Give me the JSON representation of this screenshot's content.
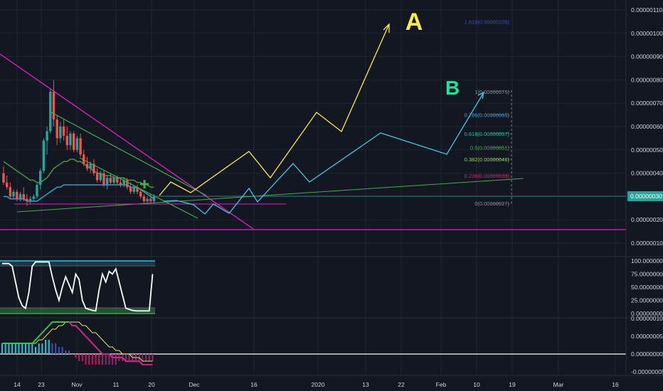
{
  "theme": {
    "background": "#131722",
    "grid": "#1f2433",
    "axis_text": "#d1d4dc",
    "bull": "#26a69a",
    "bear": "#ef5350",
    "magenta": "#e91ec8",
    "green_line": "#3fae48",
    "yellow": "#ffeb3b",
    "cyan": "#40c8e0",
    "current_price_bg": "#26a69a"
  },
  "price_axis": {
    "labels": [
      "0.00000110",
      "0.00000100",
      "0.00000090",
      "0.00000080",
      "0.00000070",
      "0.00000060",
      "0.00000050",
      "0.00000040",
      "0.00000020",
      "0.00000010"
    ],
    "current_price": "0.00000030"
  },
  "stoch_axis": {
    "labels": [
      "100.00000000",
      "75.00000000",
      "50.00000000",
      "25.00000000",
      "0.00000000"
    ]
  },
  "macd_axis": {
    "labels": [
      "0.00000010",
      "0.00000005",
      "0.00000000",
      "-0.00000005"
    ]
  },
  "time_axis": {
    "labels": [
      "14",
      "23",
      "Nov",
      "11",
      "20",
      "Dec",
      "16",
      "2020",
      "13",
      "22",
      "Feb",
      "10",
      "19",
      "Mar",
      "16"
    ]
  },
  "annotations": {
    "target_a": "A",
    "target_b": "B"
  },
  "fib_levels": [
    {
      "label": "1.618(0.00000105)",
      "value": 1.05e-06,
      "color": "#3f51b5"
    },
    {
      "label": "1(0.00000075)",
      "value": 7.5e-07,
      "color": "#8a8f9c"
    },
    {
      "label": "0.786(0.00000065)",
      "value": 6.5e-07,
      "color": "#40a8e0"
    },
    {
      "label": "0.618(0.00000057)",
      "value": 5.7e-07,
      "color": "#26c6a0"
    },
    {
      "label": "0.5(0.00000051)",
      "value": 5.1e-07,
      "color": "#4caf50"
    },
    {
      "label": "0.382(0.00000046)",
      "value": 4.6e-07,
      "color": "#9ccc65"
    },
    {
      "label": "0.236(0.00000039)",
      "value": 3.9e-07,
      "color": "#e91e63"
    },
    {
      "label": "0(0.00000027)",
      "value": 2.7e-07,
      "color": "#8a8f9c"
    }
  ],
  "chart_data": {
    "type": "candlestick",
    "y_range": [
      5e-09,
      1.15e-07
    ],
    "candles": [
      [
        4e-07,
        4.3e-07,
        3.5e-07,
        3.6e-07
      ],
      [
        3.6e-07,
        3.9e-07,
        3.3e-07,
        3.4e-07
      ],
      [
        3.4e-07,
        3.6e-07,
        2.9e-07,
        3e-07
      ],
      [
        3e-07,
        3.3e-07,
        2.9e-07,
        3.2e-07
      ],
      [
        3.2e-07,
        3.3e-07,
        2.8e-07,
        2.9e-07
      ],
      [
        2.9e-07,
        3.2e-07,
        2.8e-07,
        3.1e-07
      ],
      [
        3.1e-07,
        3.4e-07,
        2.8e-07,
        2.9e-07
      ],
      [
        2.9e-07,
        3.1e-07,
        2.6e-07,
        2.8e-07
      ],
      [
        2.8e-07,
        3e-07,
        2.7e-07,
        2.9e-07
      ],
      [
        2.9e-07,
        3.1e-07,
        2.8e-07,
        3e-07
      ],
      [
        3e-07,
        3.6e-07,
        2.9e-07,
        3.5e-07
      ],
      [
        3.5e-07,
        4.2e-07,
        3.3e-07,
        4.1e-07
      ],
      [
        4.1e-07,
        5.5e-07,
        4e-07,
        5.4e-07
      ],
      [
        5.4e-07,
        6e-07,
        4.8e-07,
        5.8e-07
      ],
      [
        5.8e-07,
        7.6e-07,
        5.7e-07,
        7.5e-07
      ],
      [
        7.5e-07,
        8e-07,
        6e-07,
        6.3e-07
      ],
      [
        6.3e-07,
        6.5e-07,
        5.2e-07,
        5.5e-07
      ],
      [
        5.5e-07,
        6.2e-07,
        5.3e-07,
        6e-07
      ],
      [
        6e-07,
        6.3e-07,
        5.4e-07,
        5.6e-07
      ],
      [
        5.6e-07,
        6e-07,
        5e-07,
        5.2e-07
      ],
      [
        5.2e-07,
        5.8e-07,
        5e-07,
        5.7e-07
      ],
      [
        5.7e-07,
        5.8e-07,
        4.9e-07,
        5e-07
      ],
      [
        5e-07,
        5.6e-07,
        4.9e-07,
        5.5e-07
      ],
      [
        5.5e-07,
        5.7e-07,
        4.7e-07,
        4.8e-07
      ],
      [
        4.8e-07,
        5e-07,
        4.3e-07,
        4.4e-07
      ],
      [
        4.4e-07,
        4.7e-07,
        4.1e-07,
        4.2e-07
      ],
      [
        4.2e-07,
        4.5e-07,
        4e-07,
        4.4e-07
      ],
      [
        4.4e-07,
        4.6e-07,
        3.9e-07,
        4e-07
      ],
      [
        4e-07,
        4.2e-07,
        3.6e-07,
        3.7e-07
      ],
      [
        3.7e-07,
        4.1e-07,
        3.6e-07,
        4e-07
      ],
      [
        4e-07,
        4.1e-07,
        3.4e-07,
        3.5e-07
      ],
      [
        3.5e-07,
        3.9e-07,
        3.3e-07,
        3.8e-07
      ],
      [
        3.8e-07,
        4e-07,
        3.5e-07,
        3.6e-07
      ],
      [
        3.6e-07,
        3.9e-07,
        3.5e-07,
        3.8e-07
      ],
      [
        3.8e-07,
        3.9e-07,
        3.5e-07,
        3.6e-07
      ],
      [
        3.6e-07,
        3.8e-07,
        3.4e-07,
        3.5e-07
      ],
      [
        3.5e-07,
        3.8e-07,
        3.4e-07,
        3.7e-07
      ],
      [
        3.7e-07,
        3.8e-07,
        3.3e-07,
        3.4e-07
      ],
      [
        3.4e-07,
        3.6e-07,
        3.1e-07,
        3.2e-07
      ],
      [
        3.2e-07,
        3.5e-07,
        3.1e-07,
        3.4e-07
      ],
      [
        3.4e-07,
        3.5e-07,
        3.1e-07,
        3.2e-07
      ],
      [
        3.2e-07,
        3.3e-07,
        2.9e-07,
        3e-07
      ],
      [
        3e-07,
        3.1e-07,
        2.7e-07,
        2.8e-07
      ],
      [
        2.8e-07,
        3e-07,
        2.7e-07,
        2.9e-07
      ],
      [
        2.9e-07,
        3.1e-07,
        2.7e-07,
        2.8e-07
      ],
      [
        2.8e-07,
        3.1e-07,
        2.7e-07,
        3e-07
      ]
    ],
    "moving_average": [
      4.5e-07,
      4.4e-07,
      4.3e-07,
      4.2e-07,
      4.1e-07,
      4e-07,
      3.9e-07,
      3.8e-07,
      3.7e-07,
      3.7e-07,
      3.6e-07,
      3.6e-07,
      3.7e-07,
      3.8e-07,
      4e-07,
      4.2e-07,
      4.3e-07,
      4.4e-07,
      4.5e-07,
      4.5e-07,
      4.6e-07,
      4.6e-07,
      4.5e-07,
      4.5e-07,
      4.4e-07,
      4.3e-07,
      4.2e-07,
      4.1e-07,
      4e-07,
      4e-07,
      3.9e-07,
      3.9e-07,
      3.9e-07,
      3.8e-07,
      3.8e-07,
      3.8e-07,
      3.8e-07,
      3.7e-07,
      3.7e-07,
      3.7e-07,
      3.6e-07,
      3.6e-07,
      3.5e-07,
      3.5e-07,
      3.4e-07,
      3.4e-07
    ],
    "ema": [
      3e-07,
      3e-07,
      2.9e-07,
      2.9e-07,
      2.9e-07,
      2.9e-07,
      2.9e-07,
      2.8e-07,
      2.8e-07,
      2.8e-07,
      2.8e-07,
      2.9e-07,
      3e-07,
      3.1e-07,
      3.2e-07,
      3.3e-07,
      3.4e-07,
      3.4e-07,
      3.5e-07,
      3.5e-07,
      3.5e-07,
      3.5e-07,
      3.5e-07,
      3.5e-07,
      3.5e-07,
      3.5e-07,
      3.5e-07,
      3.5e-07,
      3.5e-07,
      3.5e-07,
      3.5e-07,
      3.5e-07,
      3.5e-07,
      3.5e-07,
      3.5e-07,
      3.5e-07,
      3.5e-07,
      3.5e-07,
      3.4e-07,
      3.4e-07,
      3.4e-07,
      3.3e-07,
      3.2e-07,
      3.1e-07,
      3e-07,
      2.9e-07
    ],
    "stoch": [
      95,
      95,
      95,
      90,
      60,
      30,
      15,
      10,
      40,
      90,
      98,
      98,
      98,
      98,
      98,
      70,
      45,
      25,
      50,
      70,
      55,
      40,
      75,
      65,
      25,
      10,
      8,
      6,
      5,
      45,
      75,
      60,
      80,
      75,
      85,
      60,
      35,
      10,
      8,
      6,
      5,
      5,
      5,
      5,
      5,
      75
    ],
    "macd": {
      "line": [
        3e-08,
        3e-08,
        3e-08,
        3e-08,
        3e-08,
        3e-08,
        3e-08,
        3e-08,
        3e-08,
        3e-08,
        4e-08,
        5e-08,
        6e-08,
        7e-08,
        8e-08,
        9e-08,
        9e-08,
        9e-08,
        9e-08,
        9e-08,
        9e-08,
        8e-08,
        8e-08,
        7e-08,
        6e-08,
        5e-08,
        4e-08,
        3e-08,
        2e-08,
        1e-08,
        0,
        0,
        0,
        -1e-08,
        -1e-08,
        -1e-08,
        -1e-08,
        -2e-08,
        -2e-08,
        -2e-08,
        -2e-08,
        -2e-08,
        -3e-08,
        -3e-08,
        -3e-08,
        -3e-08
      ],
      "signal": [
        3e-08,
        3e-08,
        3e-08,
        3e-08,
        3e-08,
        3e-08,
        3e-08,
        3e-08,
        3e-08,
        3e-08,
        3e-08,
        4e-08,
        4e-08,
        5e-08,
        6e-08,
        7e-08,
        7e-08,
        8e-08,
        8e-08,
        9e-08,
        9e-08,
        9e-08,
        9e-08,
        9e-08,
        8e-08,
        8e-08,
        7e-08,
        6e-08,
        6e-08,
        5e-08,
        4e-08,
        3e-08,
        2e-08,
        2e-08,
        1e-08,
        1e-08,
        0,
        0,
        0,
        -1e-08,
        -1e-08,
        -1e-08,
        -2e-08,
        -2e-08,
        -2e-08,
        -2e-08
      ],
      "histogram": [
        3e-08,
        3e-08,
        3e-08,
        3e-08,
        3e-08,
        3e-08,
        3e-08,
        3e-08,
        3e-08,
        3e-08,
        2e-08,
        3e-08,
        3e-08,
        4e-08,
        4e-08,
        3e-08,
        3e-08,
        2e-08,
        2e-08,
        1e-08,
        1e-08,
        0,
        -1e-08,
        -2e-08,
        -2e-08,
        -3e-08,
        -3e-08,
        -3e-08,
        -3e-08,
        -3e-08,
        -3e-08,
        -3e-08,
        -3e-08,
        -3e-08,
        -3e-08,
        -2e-08,
        -2e-08,
        -2e-08,
        -2e-08,
        -2e-08,
        -2e-08,
        -2e-08,
        -2e-08,
        -2e-08,
        -2e-08,
        -2e-08
      ]
    }
  }
}
